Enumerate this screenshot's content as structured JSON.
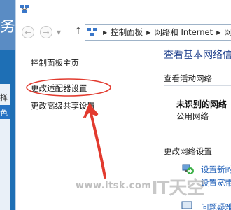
{
  "backdrop": {
    "title_fragment": "务",
    "item_fragment": "择",
    "selected_fragment": "色"
  },
  "address": {
    "segments": [
      "控制面板",
      "网络和 Internet"
    ],
    "trailing": "网"
  },
  "sidebar": {
    "items": [
      {
        "label": "控制面板主页"
      },
      {
        "label": "更改适配器设置"
      },
      {
        "label": "更改高级共享设置"
      }
    ]
  },
  "main": {
    "title": "查看基本网络信",
    "active_networks_label": "查看活动网络",
    "network_name": "未识别的网络",
    "network_type": "公用网络",
    "change_settings_label": "更改网络设置",
    "tasks": [
      {
        "label": "设置新的",
        "icon": "network-setup-icon"
      },
      {
        "label": "设置宽带",
        "icon": "broadband-icon"
      },
      {
        "label": "问题疑难",
        "icon": "troubleshoot-icon"
      }
    ]
  },
  "watermark": {
    "url": "www.itsk.com",
    "brand": "IT天空"
  },
  "colors": {
    "accent_blue": "#1e3f8c",
    "link_blue": "#1f5fb8",
    "annotation_red": "#e23a2e",
    "backdrop_blue": "#1e6fb5"
  }
}
